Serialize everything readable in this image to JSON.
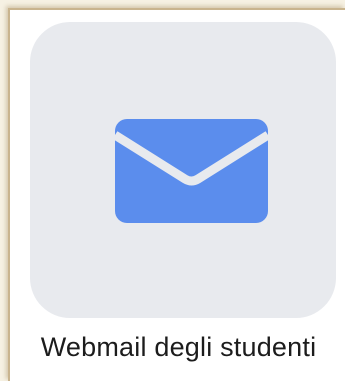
{
  "app_tile": {
    "label": "Webmail degli studenti",
    "icon": "envelope-icon",
    "tile_color": "#e8eaee",
    "icon_color": "#5b8ded"
  }
}
